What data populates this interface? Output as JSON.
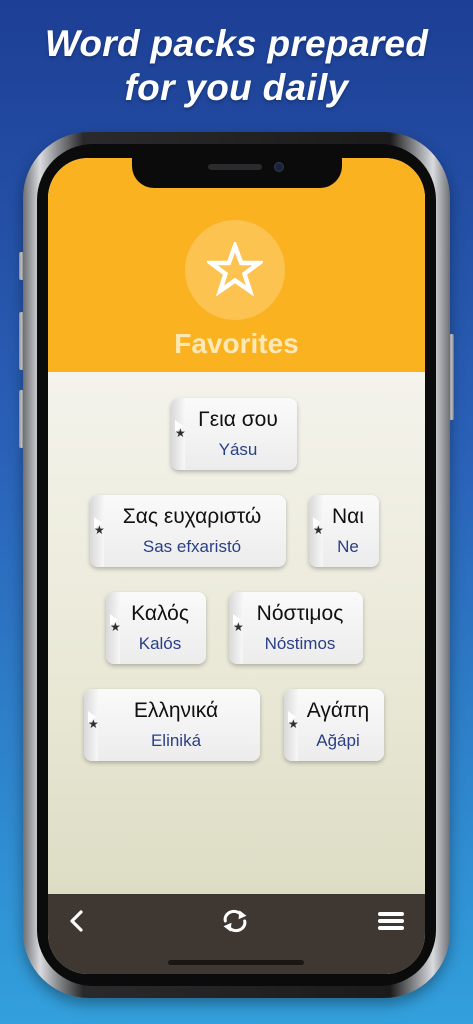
{
  "headline": {
    "line1": "Word packs prepared",
    "line2": "for you daily"
  },
  "header": {
    "title": "Favorites",
    "icon": "star-icon"
  },
  "cards": [
    {
      "word": "Γεια σου",
      "translit": "Yásu"
    },
    {
      "word": "Σας ευχαριστώ",
      "translit": "Sas efxaristó"
    },
    {
      "word": "Ναι",
      "translit": "Ne"
    },
    {
      "word": "Καλός",
      "translit": "Kalós"
    },
    {
      "word": "Νόστιμος",
      "translit": "Nóstimos"
    },
    {
      "word": "Ελληνικά",
      "translit": "Eliniká"
    },
    {
      "word": "Αγάπη",
      "translit": "Ağápi"
    }
  ],
  "card_marker_icon": "star-icon",
  "bottom_bar": {
    "left_icon": "back-chevron-icon",
    "center_icon": "refresh-icon",
    "right_icon": "menu-icon"
  },
  "colors": {
    "header": "#fbb220",
    "bottom_bar": "#3e3732",
    "translit": "#2a3f86",
    "background_top": "#1d3f95",
    "background_bottom": "#32a0dc"
  }
}
